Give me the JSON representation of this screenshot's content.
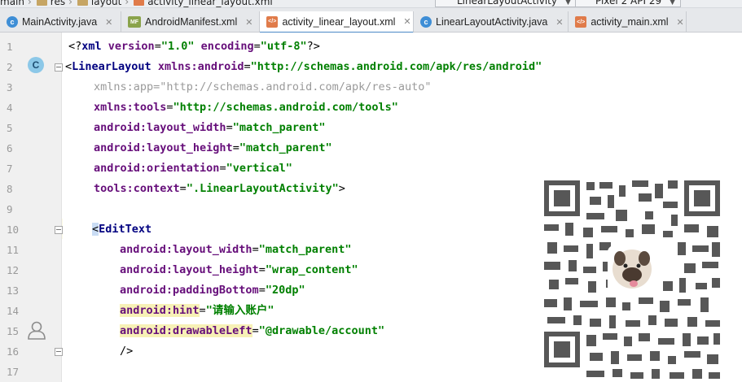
{
  "breadcrumbs": [
    "main",
    "res",
    "layout",
    "activity_linear_layout.xml"
  ],
  "run_config": "LinearLayoutActivity",
  "device": "Pixel 2 API 29",
  "tabs": [
    {
      "label": "MainActivity.java",
      "icon": "java-class-icon",
      "active": false
    },
    {
      "label": "AndroidManifest.xml",
      "icon": "manifest-icon",
      "active": false
    },
    {
      "label": "activity_linear_layout.xml",
      "icon": "xml-layout-icon",
      "active": true
    },
    {
      "label": "LinearLayoutActivity.java",
      "icon": "java-class-icon",
      "active": false
    },
    {
      "label": "activity_main.xml",
      "icon": "xml-layout-icon",
      "active": false
    }
  ],
  "line_numbers": [
    "1",
    "2",
    "3",
    "4",
    "5",
    "6",
    "7",
    "8",
    "9",
    "10",
    "11",
    "12",
    "13",
    "14",
    "15",
    "16",
    "17"
  ],
  "code": {
    "l1": {
      "p1": "<?",
      "t": "xml",
      "a1": " version",
      "e1": "=",
      "v1": "\"1.0\"",
      "a2": " encoding",
      "e2": "=",
      "v2": "\"utf-8\"",
      "p2": "?>"
    },
    "l2": {
      "lt": "<",
      "t": "LinearLayout",
      "a": " xmlns:android",
      "e": "=",
      "v": "\"http://schemas.android.com/apk/res/android\""
    },
    "l3": {
      "a": "xmlns:app",
      "e": "=",
      "v": "\"http://schemas.android.com/apk/res-auto\""
    },
    "l4": {
      "a": "xmlns:tools",
      "e": "=",
      "v": "\"http://schemas.android.com/tools\""
    },
    "l5": {
      "a": "android:layout_width",
      "e": "=",
      "v": "\"match_parent\""
    },
    "l6": {
      "a": "android:layout_height",
      "e": "=",
      "v": "\"match_parent\""
    },
    "l7": {
      "a": "android:orientation",
      "e": "=",
      "v": "\"vertical\""
    },
    "l8": {
      "a": "tools:context",
      "e": "=",
      "v": "\".LinearLayoutActivity\"",
      "gt": ">"
    },
    "l10": {
      "lt": "<",
      "t": "EditText"
    },
    "l11": {
      "a": "android:layout_width",
      "e": "=",
      "v": "\"match_parent\""
    },
    "l12": {
      "a": "android:layout_height",
      "e": "=",
      "v": "\"wrap_content\""
    },
    "l13": {
      "a": "android:paddingBottom",
      "e": "=",
      "v": "\"20dp\""
    },
    "l14": {
      "a": "android:hint",
      "e": "=",
      "v": "\"请输入账户\""
    },
    "l15": {
      "a": "android:drawableLeft",
      "e": "=",
      "v": "\"@drawable/account\""
    },
    "l16": {
      "t": "/>"
    }
  },
  "colors": {
    "tag": "#000080",
    "attribute": "#660e7a",
    "value": "#008000",
    "unused": "#9a9a9a",
    "caret_line": "#fcfbe6",
    "tab_underline": "#4a88c7"
  },
  "gutter_icons": [
    "class-link-icon",
    "intention-bulb-icon",
    "account-drawable-icon"
  ]
}
